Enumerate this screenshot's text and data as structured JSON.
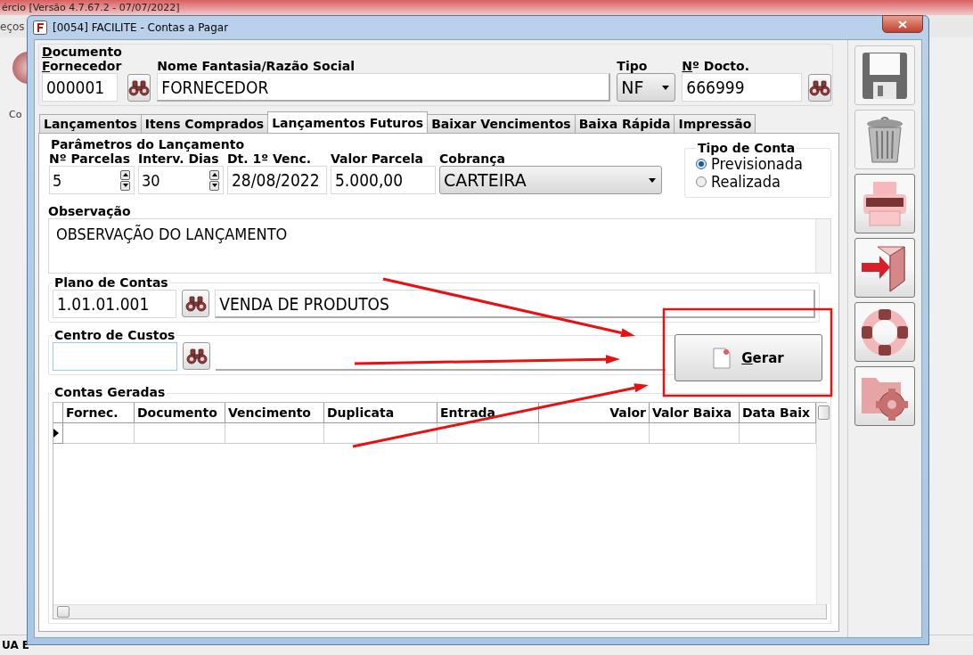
{
  "background_app": {
    "title": "ércio [Versão 4.7.67.2 - 07/07/2022]",
    "menu_text": "eços",
    "side_label": "Co",
    "status_text": "UA E"
  },
  "window": {
    "title": "[0054] FACILITE - Contas a Pagar"
  },
  "documento": {
    "title": "Documento",
    "title_underline_first": true,
    "fornecedor_label": "Fornecedor",
    "fornecedor_underline_first": true,
    "fornecedor_code": "000001",
    "nome_label": "Nome Fantasia/Razão Social",
    "nome": "FORNECEDOR",
    "tipo_label": "Tipo",
    "tipo": "NF",
    "docto_label": "Nº Docto.",
    "docto_underline_first": true,
    "docto": "666999"
  },
  "tabs": [
    {
      "label": "Lançamentos",
      "selected": false
    },
    {
      "label": "Itens Comprados",
      "selected": false
    },
    {
      "label": "Lançamentos Futuros",
      "selected": true
    },
    {
      "label": "Baixar Vencimentos",
      "selected": false
    },
    {
      "label": "Baixa Rápida",
      "selected": false
    },
    {
      "label": "Impressão",
      "selected": false
    }
  ],
  "parametros": {
    "title": "Parâmetros do Lançamento",
    "fields": [
      {
        "label": "Nº Parcelas",
        "value": "5",
        "kind": "spin"
      },
      {
        "label": "Interv. Dias",
        "value": "30",
        "kind": "spin"
      },
      {
        "label": "Dt. 1º Venc.",
        "value": "28/08/2022",
        "kind": "text"
      },
      {
        "label": "Valor Parcela",
        "value": "5.000,00",
        "kind": "text"
      },
      {
        "label": "Cobrança",
        "value": "CARTEIRA",
        "kind": "select"
      }
    ]
  },
  "tipo_de_conta": {
    "title": "Tipo de Conta",
    "options": [
      {
        "label": "Previsionada",
        "selected": true
      },
      {
        "label": "Realizada",
        "selected": false
      }
    ]
  },
  "observacao": {
    "label": "Observação",
    "value": "OBSERVAÇÃO DO LANÇAMENTO"
  },
  "plano_de_contas": {
    "title": "Plano de Contas",
    "code": "1.01.01.001",
    "description": "VENDA DE PRODUTOS"
  },
  "centro_de_custos": {
    "title": "Centro de Custos"
  },
  "gerar_button": {
    "label": "Gerar",
    "underline_first": true
  },
  "contas_geradas": {
    "title": "Contas Geradas",
    "columns": [
      {
        "label": "Fornec.",
        "kind": "text"
      },
      {
        "label": "Documento",
        "kind": "text"
      },
      {
        "label": "Vencimento",
        "kind": "text"
      },
      {
        "label": "Duplicata",
        "kind": "text"
      },
      {
        "label": "Entrada",
        "kind": "text"
      },
      {
        "label": "Valor",
        "kind": "number"
      },
      {
        "label": "Valor Baixa",
        "kind": "text"
      },
      {
        "label": "Data Baix",
        "kind": "text"
      }
    ]
  },
  "toolbar": [
    {
      "kind": "save",
      "disabled": true
    },
    {
      "kind": "delete",
      "disabled": true
    },
    {
      "kind": "print",
      "disabled": false
    },
    {
      "kind": "exit",
      "disabled": false
    },
    {
      "kind": "help",
      "disabled": false
    },
    {
      "kind": "settings",
      "disabled": false
    }
  ]
}
